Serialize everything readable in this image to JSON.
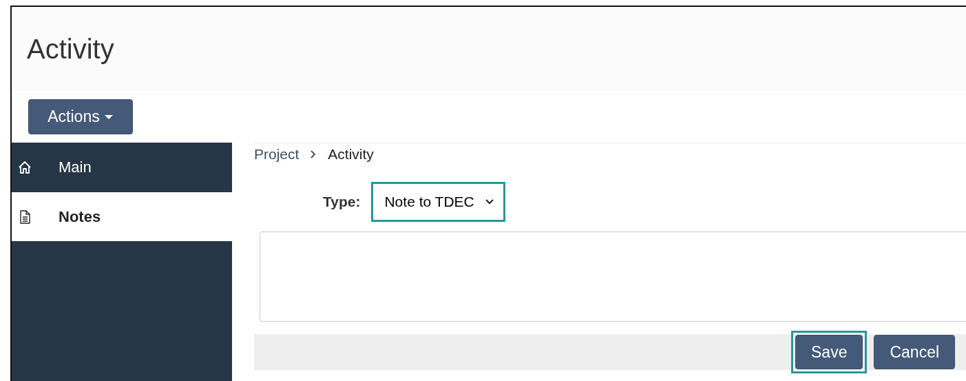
{
  "page": {
    "title": "Activity"
  },
  "actions_button": {
    "label": "Actions"
  },
  "sidebar": {
    "items": [
      {
        "label": "Main",
        "kind": "home",
        "selected": false
      },
      {
        "label": "Notes",
        "kind": "document",
        "selected": true
      }
    ]
  },
  "breadcrumb": [
    {
      "label": "Project",
      "kind": "link"
    },
    {
      "label": "Activity",
      "kind": "current"
    }
  ],
  "type_field": {
    "label": "Type:",
    "value": "Note to TDEC",
    "highlighted": true
  },
  "buttons": [
    {
      "label": "Save",
      "highlighted": true
    },
    {
      "label": "Cancel",
      "highlighted": false
    }
  ]
}
